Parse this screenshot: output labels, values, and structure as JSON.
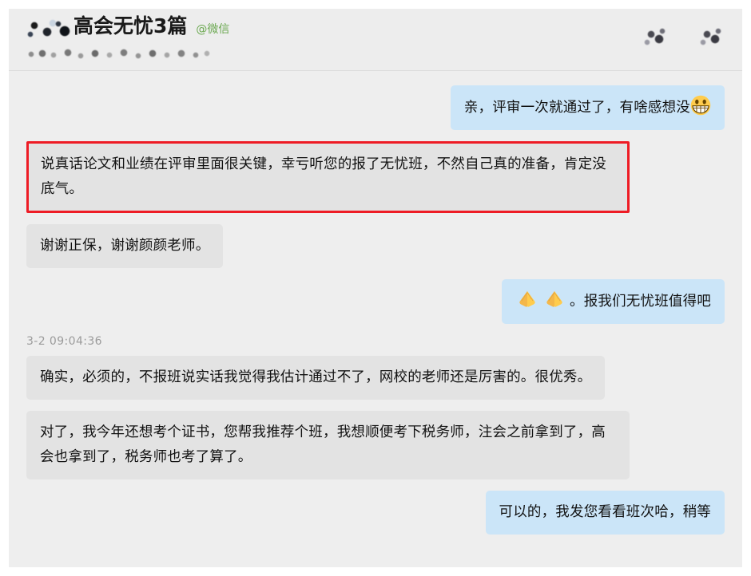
{
  "header": {
    "title": "高会无忧3篇",
    "source": "@微信",
    "censored_name_hint": "blurred-nickname",
    "censored_subtitle_hint": "blurred-subtitle",
    "icons": [
      {
        "name": "header-icon-1",
        "label": "blurred-icon"
      },
      {
        "name": "header-icon-2",
        "label": "blurred-icon"
      }
    ]
  },
  "colors": {
    "outgoing_bubble": "#cbe5f8",
    "incoming_bubble": "#e3e3e3",
    "highlight_border": "#ee1c25",
    "source_green": "#6aa84f",
    "background": "#eeeeee",
    "header_background": "#ededed",
    "timestamp_gray": "#9b9b9b"
  },
  "timestamp": "3-2 09:04:36",
  "messages": [
    {
      "id": "msg-1",
      "side": "outgoing",
      "highlight": false,
      "text": "亲，评审一次就通过了，有啥感想没",
      "trailing_emoji": "grinning-face-emoji"
    },
    {
      "id": "msg-2",
      "side": "incoming",
      "highlight": true,
      "text": "说真话论文和业绩在评审里面很关键，幸亏听您的报了无忧班，不然自己真的准备，肯定没底气。"
    },
    {
      "id": "msg-3",
      "side": "incoming",
      "highlight": false,
      "text": "谢谢正保，谢谢颜颜老师。"
    },
    {
      "id": "msg-4",
      "side": "outgoing",
      "highlight": false,
      "leading_emoji": "folded-hands-emoji",
      "text": "。报我们无忧班值得吧"
    },
    {
      "id": "msg-5",
      "side": "incoming",
      "highlight": false,
      "text": "确实，必须的，不报班说实话我觉得我估计通过不了，网校的老师还是厉害的。很优秀。"
    },
    {
      "id": "msg-6",
      "side": "incoming",
      "highlight": false,
      "text": "对了，我今年还想考个证书，您帮我推荐个班，我想顺便考下税务师，注会之前拿到了，高会也拿到了，税务师也考了算了。"
    },
    {
      "id": "msg-7",
      "side": "outgoing",
      "highlight": false,
      "text": "可以的，我发您看看班次哈，稍等"
    }
  ]
}
